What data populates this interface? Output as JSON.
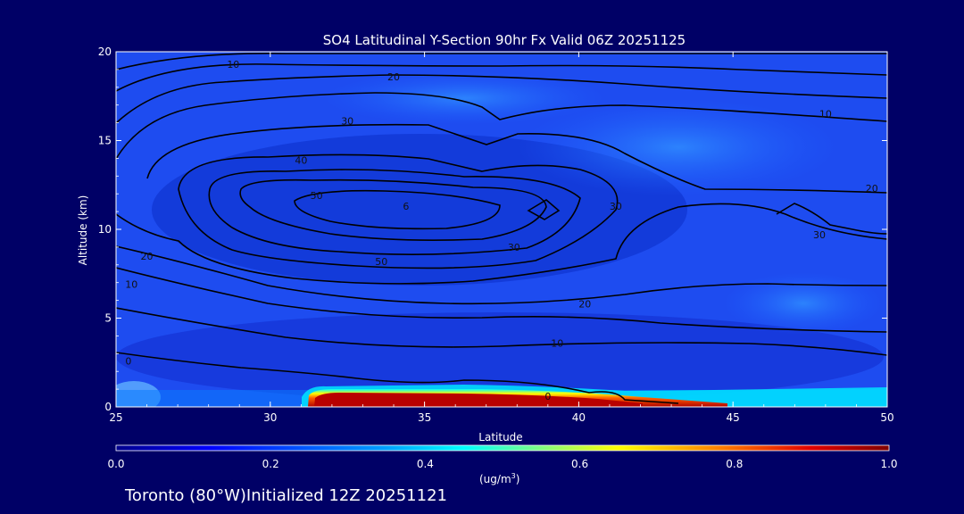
{
  "chart_data": {
    "type": "heatmap",
    "title": "SO4 Latitudinal Y-Section 90hr  Fx Valid 06Z 20251125",
    "xlabel": "Latitude",
    "ylabel": "Altitude (km)",
    "xlim": [
      25,
      50
    ],
    "ylim": [
      0,
      20
    ],
    "x_ticks": [
      "25",
      "30",
      "35",
      "40",
      "45",
      "50"
    ],
    "y_ticks": [
      "0",
      "5",
      "10",
      "15",
      "20"
    ],
    "colorbar": {
      "ticks": [
        "0.0",
        "0.2",
        "0.4",
        "0.6",
        "0.8",
        "1.0"
      ],
      "unit_label": "(ug/m",
      "unit_superscript": "3",
      "unit_close": ")"
    },
    "footer": "Toronto (80°W)Initialized 12Z 20251121",
    "contour_labels": [
      {
        "text": "10",
        "lat": 28.8,
        "alt": 19.3
      },
      {
        "text": "20",
        "lat": 34.0,
        "alt": 18.6
      },
      {
        "text": "30",
        "lat": 32.5,
        "alt": 16.1
      },
      {
        "text": "40",
        "lat": 31.0,
        "alt": 13.9
      },
      {
        "text": "50",
        "lat": 31.5,
        "alt": 11.9
      },
      {
        "text": "6",
        "lat": 34.4,
        "alt": 11.3
      },
      {
        "text": "50",
        "lat": 33.6,
        "alt": 8.2
      },
      {
        "text": "30",
        "lat": 41.2,
        "alt": 11.3
      },
      {
        "text": "30",
        "lat": 37.9,
        "alt": 9.0
      },
      {
        "text": "20",
        "lat": 26.0,
        "alt": 8.5
      },
      {
        "text": "10",
        "lat": 25.5,
        "alt": 6.9
      },
      {
        "text": "20",
        "lat": 40.2,
        "alt": 5.8
      },
      {
        "text": "10",
        "lat": 39.3,
        "alt": 3.6
      },
      {
        "text": "0",
        "lat": 25.4,
        "alt": 2.6
      },
      {
        "text": "0",
        "lat": 39.0,
        "alt": 0.6
      },
      {
        "text": "10",
        "lat": 48.0,
        "alt": 16.5
      },
      {
        "text": "20",
        "lat": 49.5,
        "alt": 12.3
      },
      {
        "text": "30",
        "lat": 47.8,
        "alt": 9.7
      }
    ]
  }
}
